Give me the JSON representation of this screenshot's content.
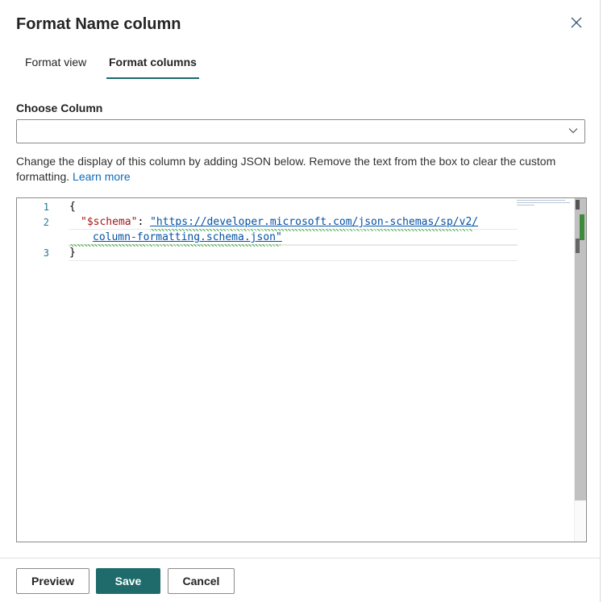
{
  "panel": {
    "title": "Format Name column"
  },
  "tabs": [
    {
      "label": "Format view",
      "selected": false
    },
    {
      "label": "Format columns",
      "selected": true
    }
  ],
  "column_select": {
    "label": "Choose Column",
    "value": ""
  },
  "description": {
    "text": "Change the display of this column by adding JSON below. Remove the text from the box to clear the custom formatting.",
    "link_label": "Learn more"
  },
  "editor": {
    "line_numbers": [
      "1",
      "2",
      "",
      "3"
    ],
    "lines": {
      "open_brace": "{",
      "key": "\"$schema\"",
      "colon": ": ",
      "url_part1": "\"https://developer.microsoft.com/json-schemas/sp/v2/",
      "url_part2": "column-formatting.schema.json\"",
      "close_brace": "}"
    }
  },
  "footer": {
    "preview_label": "Preview",
    "save_label": "Save",
    "cancel_label": "Cancel"
  },
  "colors": {
    "accent": "#1f6b6b",
    "link": "#0f6cbd",
    "json_key": "#a31515",
    "json_string": "#0451a5"
  },
  "icons": {
    "close": "close-icon",
    "dropdown": "chevron-down-icon"
  }
}
